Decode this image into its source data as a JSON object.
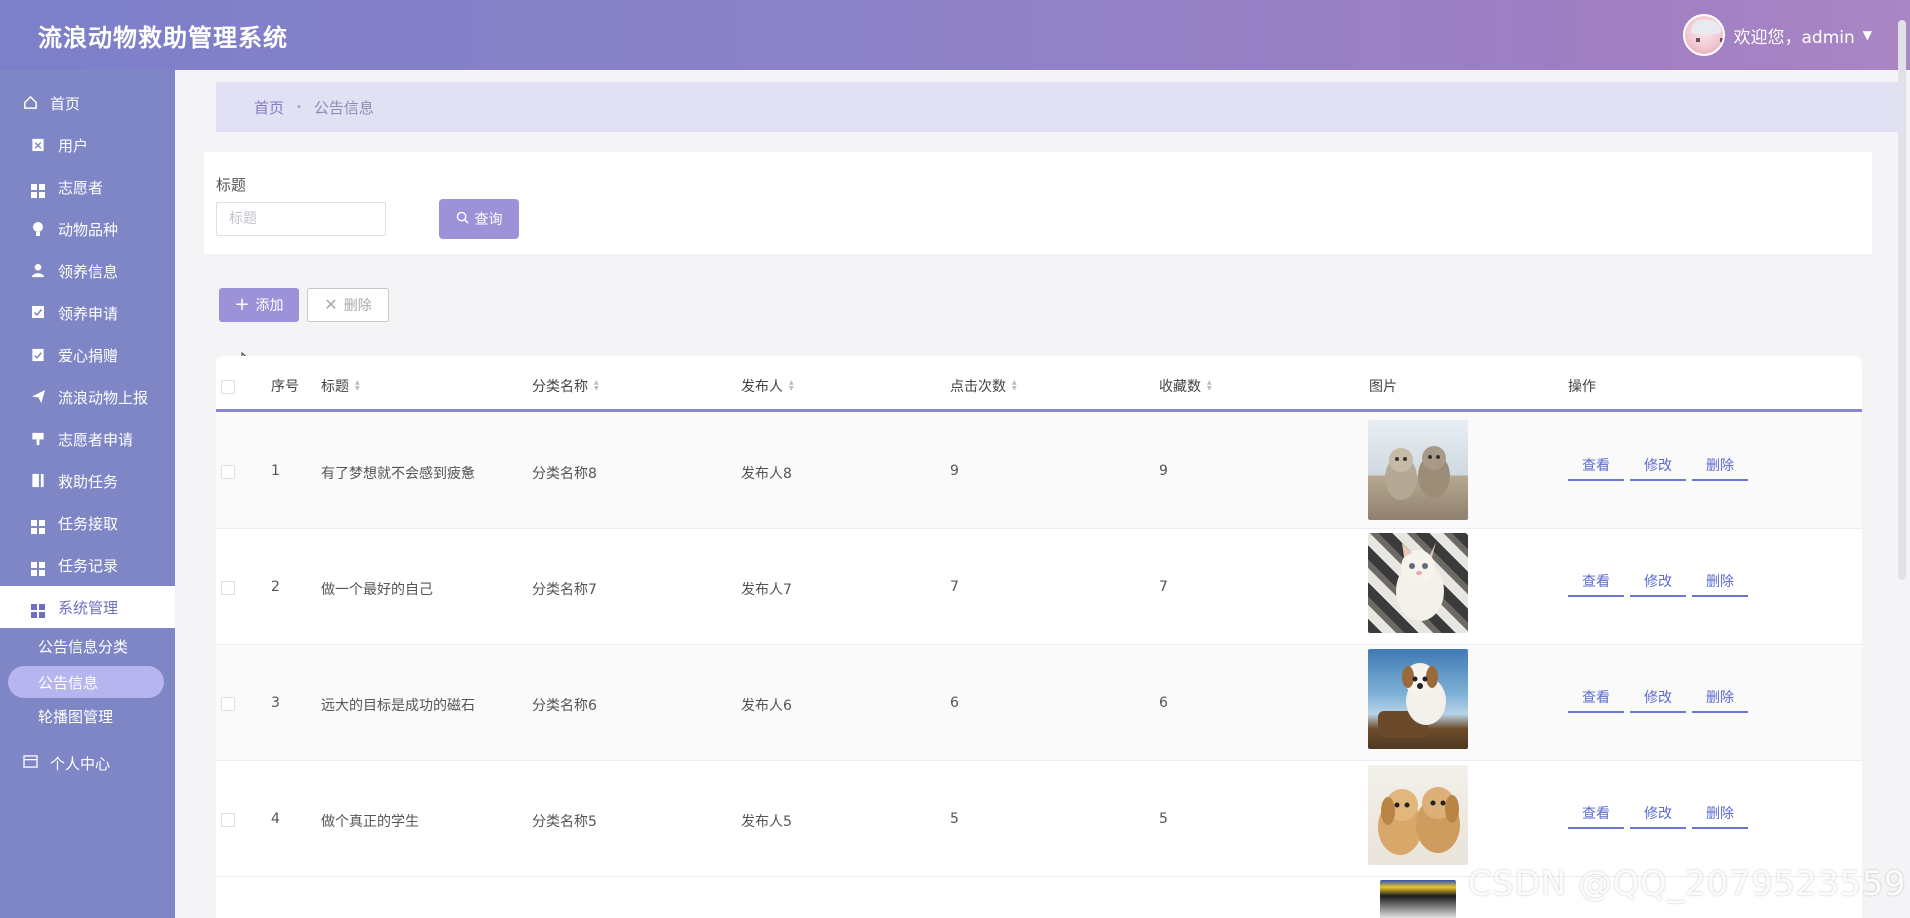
{
  "header": {
    "app_title": "流浪动物救助管理系统",
    "welcome": "欢迎您，admin",
    "caret": "▼"
  },
  "sidebar": {
    "home": "首页",
    "items": [
      {
        "label": "用户",
        "icon": "clipboard-x-icon"
      },
      {
        "label": "志愿者",
        "icon": "grid-icon"
      },
      {
        "label": "动物品种",
        "icon": "bulb-icon"
      },
      {
        "label": "领养信息",
        "icon": "user-icon"
      },
      {
        "label": "领养申请",
        "icon": "check-square-icon"
      },
      {
        "label": "爱心捐赠",
        "icon": "clipboard-check-icon"
      },
      {
        "label": "流浪动物上报",
        "icon": "send-icon"
      },
      {
        "label": "志愿者申请",
        "icon": "podium-icon"
      },
      {
        "label": "救助任务",
        "icon": "book-icon"
      },
      {
        "label": "任务接取",
        "icon": "grid-icon"
      },
      {
        "label": "任务记录",
        "icon": "grid-icon"
      },
      {
        "label": "系统管理",
        "icon": "grid-icon"
      }
    ],
    "children": [
      "公告信息分类",
      "公告信息",
      "轮播图管理"
    ],
    "personal": "个人中心"
  },
  "breadcrumb": {
    "home": "首页",
    "sep": "•",
    "current": "公告信息"
  },
  "search": {
    "label": "标题",
    "placeholder": "标题",
    "button": "查询"
  },
  "actions": {
    "add": "添加",
    "delete": "删除"
  },
  "table": {
    "columns": [
      "序号",
      "标题",
      "分类名称",
      "发布人",
      "点击次数",
      "收藏数",
      "图片",
      "操作"
    ],
    "rows": [
      {
        "index": "1",
        "title": "有了梦想就不会感到疲惫",
        "category": "分类名称8",
        "publisher": "发布人8",
        "clicks": "9",
        "favorites": "9",
        "image": "two-kittens-photo"
      },
      {
        "index": "2",
        "title": "做一个最好的自己",
        "category": "分类名称7",
        "publisher": "发布人7",
        "clicks": "7",
        "favorites": "7",
        "image": "kitten-on-plaid-photo"
      },
      {
        "index": "3",
        "title": "远大的目标是成功的磁石",
        "category": "分类名称6",
        "publisher": "发布人6",
        "clicks": "6",
        "favorites": "6",
        "image": "puppy-on-stump-photo"
      },
      {
        "index": "4",
        "title": "做个真正的学生",
        "category": "分类名称5",
        "publisher": "发布人5",
        "clicks": "5",
        "favorites": "5",
        "image": "two-puppies-photo"
      }
    ],
    "row_actions": {
      "view": "查看",
      "edit": "修改",
      "delete": "删除"
    }
  },
  "watermark": "CSDN @QQ_2079523559"
}
